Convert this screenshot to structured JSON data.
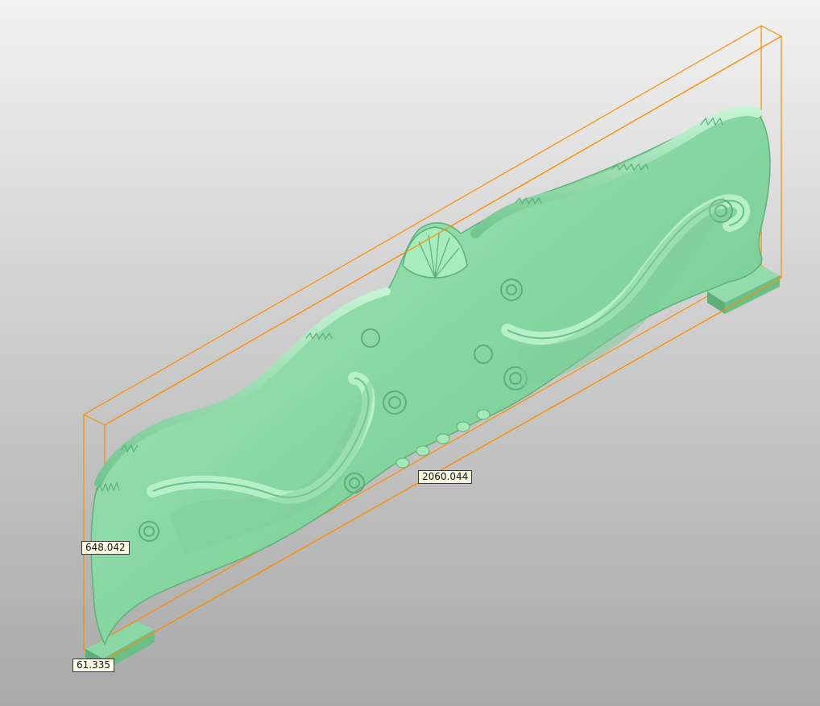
{
  "viewport": {
    "model_color": "#8fdcaa",
    "bbox_color": "#ff8c00",
    "background_top": "#f2f2f2",
    "background_bottom": "#a9a9a9"
  },
  "dimensions": {
    "length": "2060.044",
    "height": "648.042",
    "depth": "61.335"
  }
}
